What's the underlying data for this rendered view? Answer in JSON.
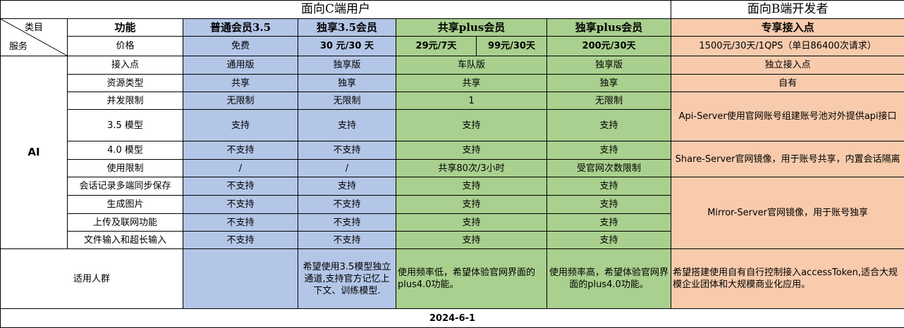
{
  "header": {
    "c_side": "面向C端用户",
    "b_side": "面向B端开发者"
  },
  "corner": {
    "top_right": "类目",
    "bottom_left": "服务"
  },
  "columns": {
    "feature": "功能",
    "basic35": "普通会员3.5",
    "exclusive35": "独享3.5会员",
    "shared_plus": "共享plus会员",
    "exclusive_plus": "独享plus会员",
    "endpoint": "专享接入点"
  },
  "price": {
    "label": "价格",
    "basic35": "免费",
    "exclusive35": "30 元/30 天",
    "shared_plus_week": "29元/7天",
    "shared_plus_month": "99元/30天",
    "exclusive_plus": "200元/30天",
    "endpoint": "1500元/30天/1QPS（单日86400次请求）"
  },
  "category": "AI",
  "rows": [
    {
      "label": "接入点",
      "basic35": "通用版",
      "exclusive35": "独享版",
      "shared_plus": "车队版",
      "exclusive_plus": "独享版",
      "endpoint": "独立接入点"
    },
    {
      "label": "资源类型",
      "basic35": "共享",
      "exclusive35": "独享",
      "shared_plus": "共享",
      "exclusive_plus": "独享",
      "endpoint": "自有"
    },
    {
      "label": "并发限制",
      "basic35": "无限制",
      "exclusive35": "无限制",
      "shared_plus": "1",
      "exclusive_plus": "无限制"
    },
    {
      "label": "3.5 模型",
      "basic35": "支持",
      "exclusive35": "支持",
      "shared_plus": "支持",
      "exclusive_plus": "支持"
    },
    {
      "label": "4.0 模型",
      "basic35": "不支持",
      "exclusive35": "不支持",
      "shared_plus": "支持",
      "exclusive_plus": "支持"
    },
    {
      "label": "使用限制",
      "basic35": "/",
      "exclusive35": "/",
      "shared_plus": "共享80次/3小时",
      "exclusive_plus": "受官网次数限制"
    },
    {
      "label": "会话记录多端同步保存",
      "basic35": "不支持",
      "exclusive35": "支持",
      "shared_plus": "支持",
      "exclusive_plus": "支持"
    },
    {
      "label": "生成图片",
      "basic35": "不支持",
      "exclusive35": "不支持",
      "shared_plus": "支持",
      "exclusive_plus": "支持"
    },
    {
      "label": "上传及联网功能",
      "basic35": "不支持",
      "exclusive35": "不支持",
      "shared_plus": "支持",
      "exclusive_plus": "支持"
    },
    {
      "label": "文件输入和超长输入",
      "basic35": "不支持",
      "exclusive35": "不支持",
      "shared_plus": "支持",
      "exclusive_plus": "支持"
    }
  ],
  "endpoint_notes": {
    "api_server": "Api-Server使用官网账号组建账号池对外提供api接口",
    "share_server": "Share-Server官网镜像，用于账号共享，内置会话隔离",
    "mirror_server": "Mirror-Server官网镜像，用于账号独享"
  },
  "audience": {
    "label": "适用人群",
    "basic35": "",
    "exclusive35": "希望使用3.5模型独立通道,支持官方记忆上下文、训练模型.",
    "shared_plus": "使用频率低，希望体验官网界面的plus4.0功能。",
    "exclusive_plus": "使用频率高，希望体验官网界面的plus4.0功能。",
    "endpoint": "希望搭建使用自有自行控制接入accessToken,适合大规模企业团体和大规模商业化应用。"
  },
  "footer": {
    "date": "2024-6-1"
  },
  "colors": {
    "blue": "#b4c6e7",
    "green": "#a9d08e",
    "orange": "#f8cbad"
  }
}
